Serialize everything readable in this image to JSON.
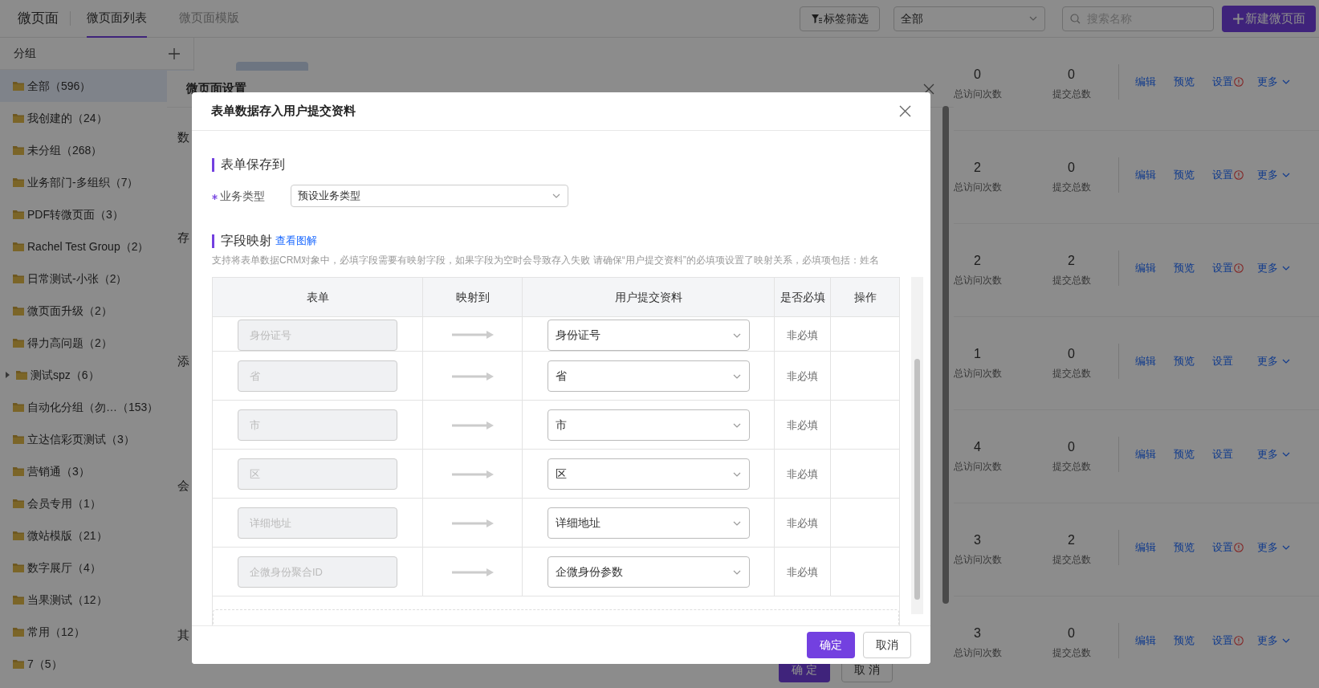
{
  "header": {
    "title": "微页面",
    "tabs": [
      {
        "label": "微页面列表",
        "selected": true
      },
      {
        "label": "微页面模版",
        "selected": false
      }
    ],
    "tag_filter": "标签筛选",
    "scope_select": "全部",
    "search": {
      "placeholder": "搜索名称"
    },
    "new_button": "新建微页面"
  },
  "sidebar": {
    "title": "分组",
    "groups": [
      {
        "label": "全部（596）",
        "selected": true,
        "has_children": false
      },
      {
        "label": "我创建的（24）",
        "selected": false,
        "has_children": false
      },
      {
        "label": "未分组（268）",
        "selected": false,
        "has_children": false
      },
      {
        "label": "业务部门-多组织（7）",
        "selected": false,
        "has_children": false
      },
      {
        "label": "PDF转微页面（3）",
        "selected": false,
        "has_children": false
      },
      {
        "label": "Rachel Test Group（2）",
        "selected": false,
        "has_children": false
      },
      {
        "label": "日常测试-小张（2）",
        "selected": false,
        "has_children": false
      },
      {
        "label": "微页面升级（2）",
        "selected": false,
        "has_children": false
      },
      {
        "label": "得力高问题（2）",
        "selected": false,
        "has_children": false
      },
      {
        "label": "测试spz（6）",
        "selected": false,
        "has_children": true
      },
      {
        "label": "自动化分组（勿…（153）",
        "selected": false,
        "has_children": false
      },
      {
        "label": "立达信彩页测试（3）",
        "selected": false,
        "has_children": false
      },
      {
        "label": "营销通（3）",
        "selected": false,
        "has_children": false
      },
      {
        "label": "会员专用（1）",
        "selected": false,
        "has_children": false
      },
      {
        "label": "微站模版（21）",
        "selected": false,
        "has_children": false
      },
      {
        "label": "数字展厅（4）",
        "selected": false,
        "has_children": false
      },
      {
        "label": "当果测试（12）",
        "selected": false,
        "has_children": false
      },
      {
        "label": "常用（12）",
        "selected": false,
        "has_children": false
      },
      {
        "label": "7（5）",
        "selected": false,
        "has_children": false
      }
    ]
  },
  "pages": {
    "rows": [
      {
        "visits": "0",
        "visits_label": "总访问次数",
        "submissions": "0",
        "submissions_label": "提交总数",
        "edit": "编辑",
        "preview": "预览",
        "settings": "设置",
        "settings_warning": true,
        "more": "更多"
      },
      {
        "visits": "2",
        "visits_label": "总访问次数",
        "submissions": "0",
        "submissions_label": "提交总数",
        "edit": "编辑",
        "preview": "预览",
        "settings": "设置",
        "settings_warning": true,
        "more": "更多"
      },
      {
        "visits": "2",
        "visits_label": "总访问次数",
        "submissions": "2",
        "submissions_label": "提交总数",
        "edit": "编辑",
        "preview": "预览",
        "settings": "设置",
        "settings_warning": true,
        "more": "更多"
      },
      {
        "visits": "1",
        "visits_label": "总访问次数",
        "submissions": "0",
        "submissions_label": "提交总数",
        "edit": "编辑",
        "preview": "预览",
        "settings": "设置",
        "settings_warning": false,
        "more": "更多"
      },
      {
        "visits": "4",
        "visits_label": "总访问次数",
        "submissions": "0",
        "submissions_label": "提交总数",
        "edit": "编辑",
        "preview": "预览",
        "settings": "设置",
        "settings_warning": false,
        "more": "更多"
      },
      {
        "visits": "3",
        "visits_label": "总访问次数",
        "submissions": "2",
        "submissions_label": "提交总数",
        "edit": "编辑",
        "preview": "预览",
        "settings": "设置",
        "settings_warning": true,
        "more": "更多"
      },
      {
        "visits": "3",
        "visits_label": "总访问次数",
        "submissions": "0",
        "submissions_label": "提交总数",
        "edit": "编辑",
        "preview": "预览",
        "settings": "设置",
        "settings_warning": true,
        "more": "更多"
      }
    ]
  },
  "settings_dialog": {
    "title": "微页面设置",
    "side_labels": [
      "数",
      "存",
      "添",
      "会",
      "其"
    ],
    "ok": "确 定",
    "cancel": "取 消"
  },
  "mapping_dialog": {
    "title": "表单数据存入用户提交资料",
    "save_section": "表单保存到",
    "business_type": {
      "label": "业务类型",
      "required": true,
      "value": "预设业务类型"
    },
    "mapping_section": "字段映射",
    "diagram_link": "查看图解",
    "description": "支持将表单数据CRM对象中，必填字段需要有映射字段，如果字段为空时会导致存入失败 请确保“用户提交资料”的必填项设置了映射关系，必填项包括：姓名",
    "columns": [
      "表单",
      "映射到",
      "用户提交资料",
      "是否必填",
      "操作"
    ],
    "rows": [
      {
        "placeholder": "身份证号",
        "target": "身份证号",
        "required": "非必填"
      },
      {
        "placeholder": "省",
        "target": "省",
        "required": "非必填"
      },
      {
        "placeholder": "市",
        "target": "市",
        "required": "非必填"
      },
      {
        "placeholder": "区",
        "target": "区",
        "required": "非必填"
      },
      {
        "placeholder": "详细地址",
        "target": "详细地址",
        "required": "非必填"
      },
      {
        "placeholder": "企微身份聚合ID",
        "target": "企微身份参数",
        "required": "非必填"
      }
    ],
    "ok": "确定",
    "cancel": "取消"
  }
}
